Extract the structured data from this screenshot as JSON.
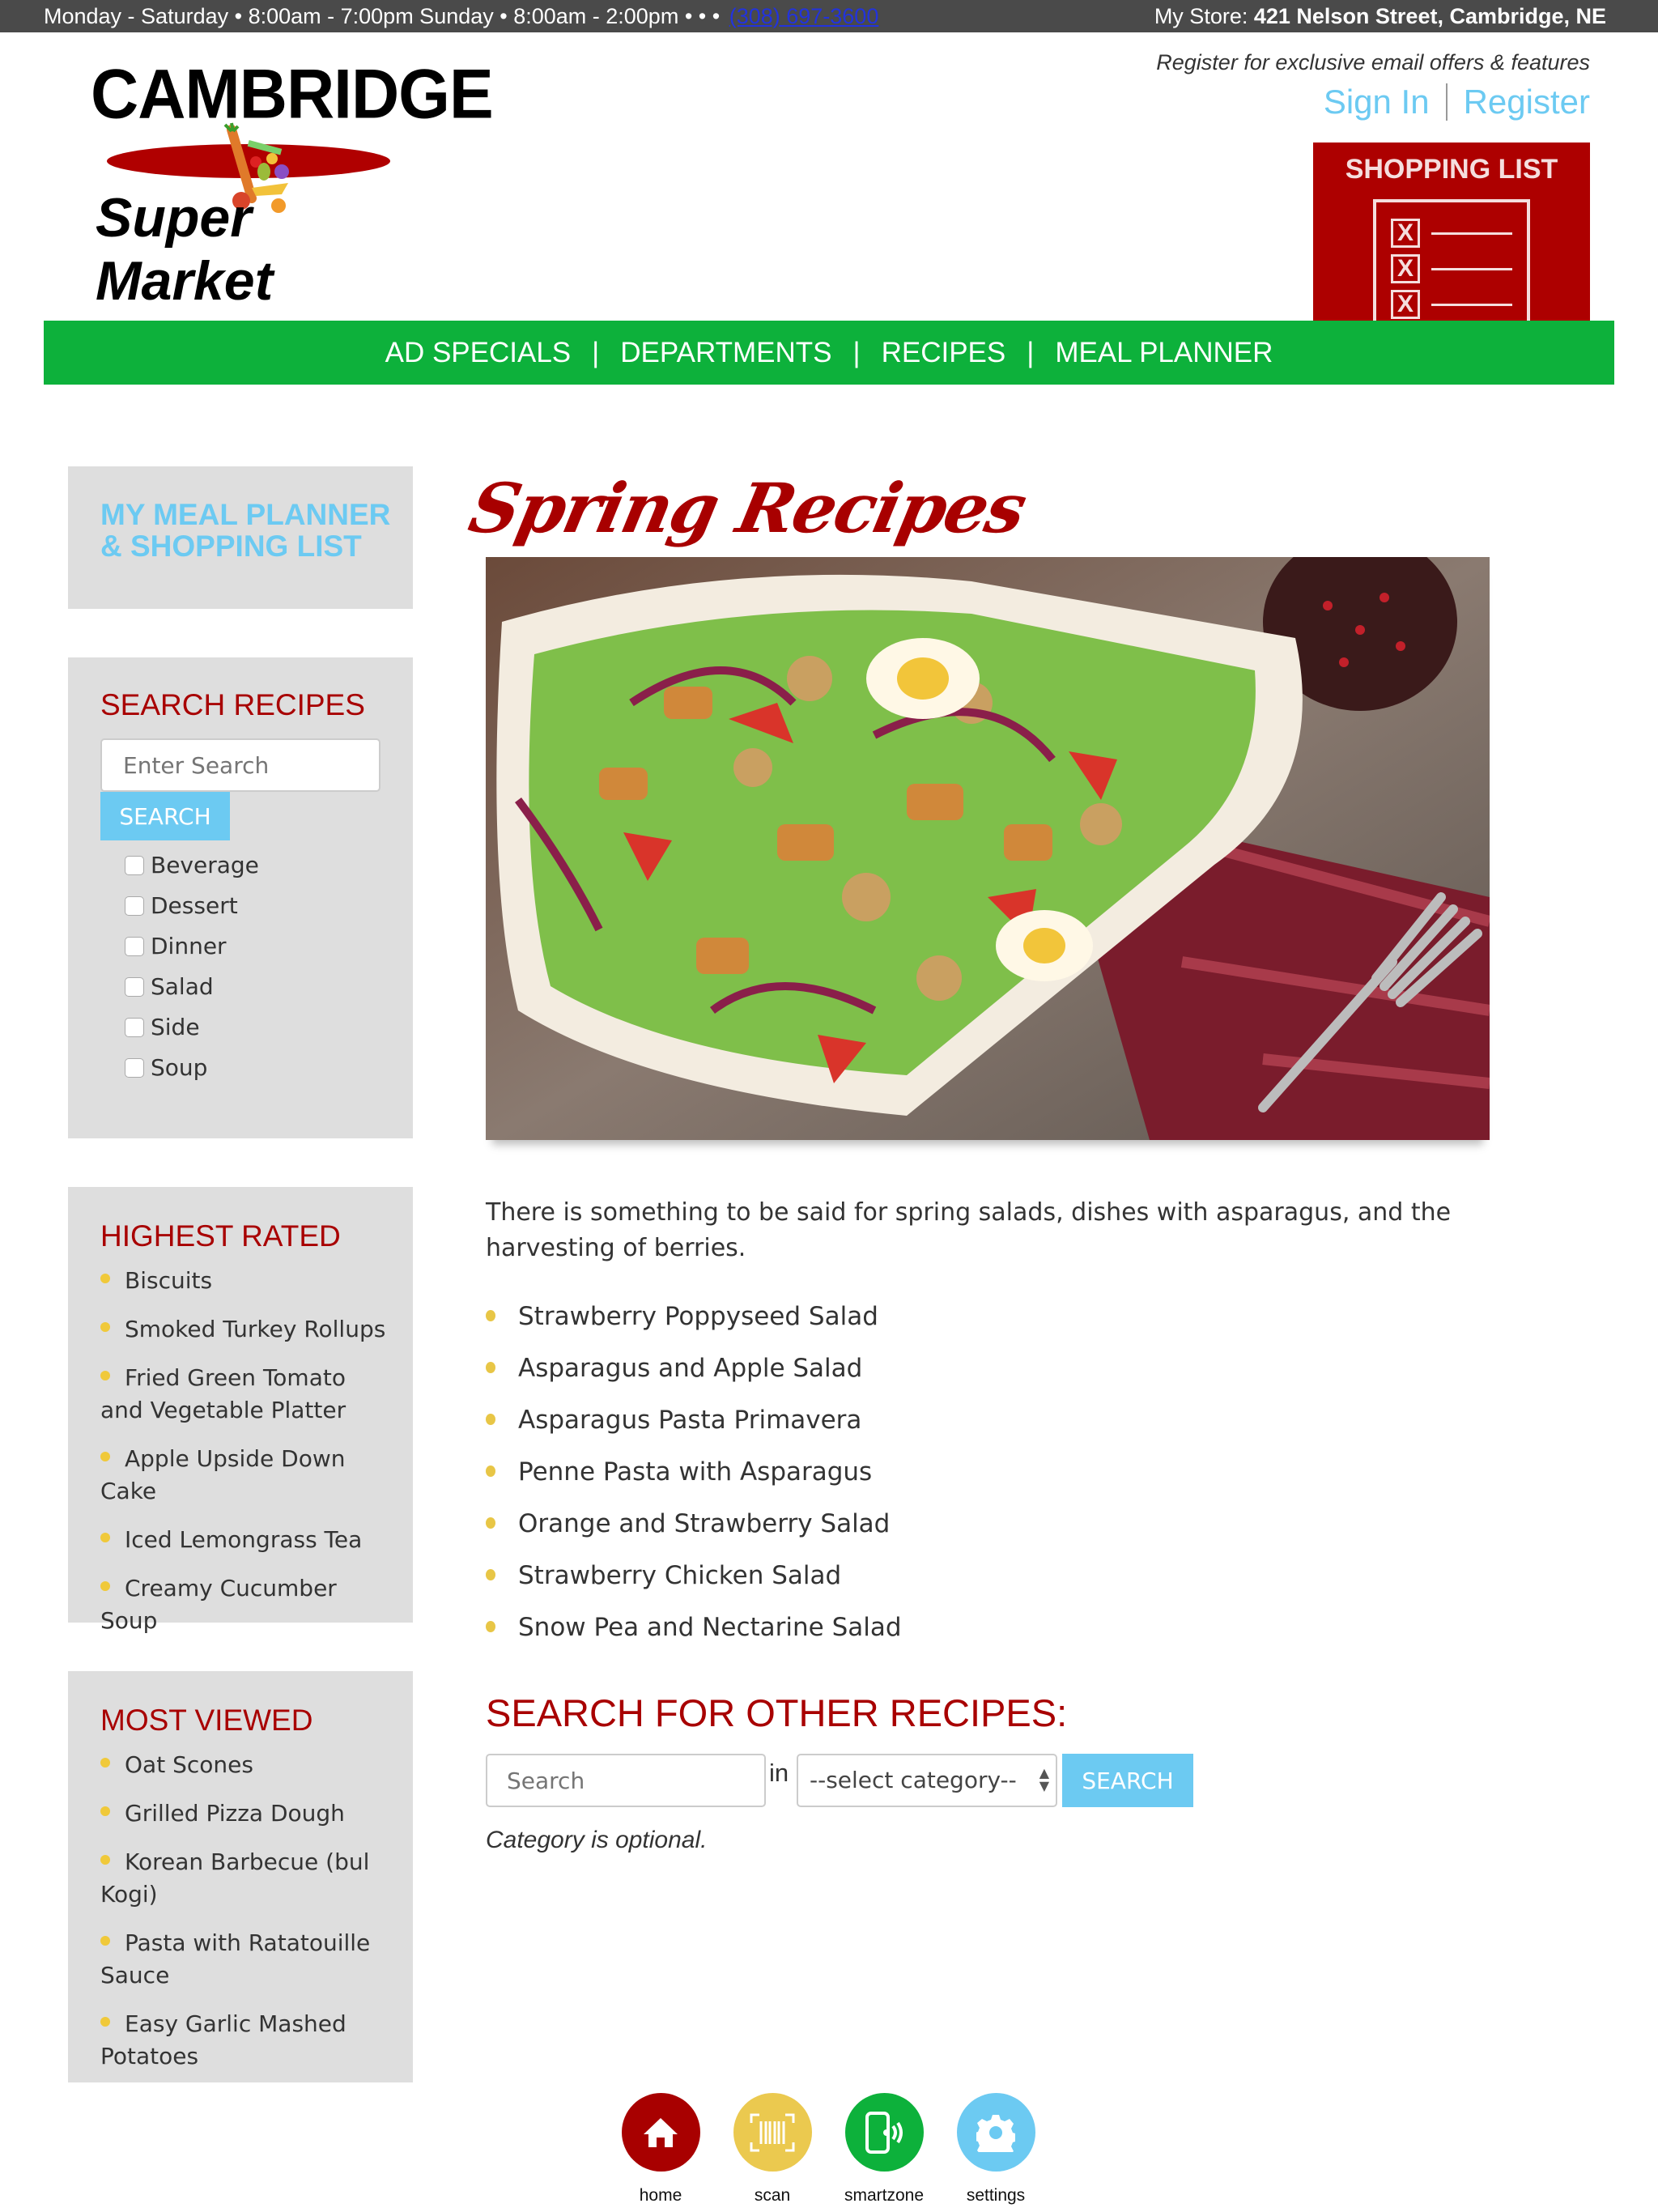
{
  "topbar": {
    "hours": "Monday - Saturday • 8:00am - 7:00pm Sunday • 8:00am - 2:00pm • • •",
    "phone": "(308) 697-3600",
    "store_label": "My Store:",
    "store_address": "421 Nelson Street, Cambridge, NE"
  },
  "logo": {
    "line1": "CAMBRIDGE",
    "line2": "Super Market"
  },
  "account": {
    "register_prompt": "Register for exclusive email offers & features",
    "sign_in": "Sign In",
    "register": "Register"
  },
  "shopping_list_badge": {
    "label": "SHOPPING LIST",
    "icon": "checklist-icon"
  },
  "nav": {
    "items": [
      "AD SPECIALS",
      "DEPARTMENTS",
      "RECIPES",
      "MEAL PLANNER"
    ],
    "separator": "|"
  },
  "sidebar": {
    "meal_planner": {
      "line1": "MY MEAL PLANNER",
      "line2": "& SHOPPING LIST"
    },
    "search": {
      "title": "SEARCH RECIPES",
      "placeholder": "Enter Search",
      "button": "SEARCH",
      "categories": [
        "Beverage",
        "Dessert",
        "Dinner",
        "Salad",
        "Side",
        "Soup"
      ]
    },
    "highest_rated": {
      "title": "HIGHEST RATED",
      "items": [
        "Biscuits",
        "Smoked Turkey Rollups",
        "Fried Green Tomato and Vegetable Platter",
        "Apple Upside Down Cake",
        "Iced Lemongrass Tea",
        "Creamy Cucumber Soup"
      ]
    },
    "most_viewed": {
      "title": "MOST VIEWED",
      "items": [
        "Oat Scones",
        "Grilled Pizza Dough",
        "Korean Barbecue (bul Kogi)",
        "Pasta with Ratatouille Sauce",
        "Easy Garlic Mashed Potatoes"
      ]
    }
  },
  "main": {
    "title": "Spring Recipes",
    "hero_alt": "salad-with-chicken-walnuts-egg-tomato",
    "intro": "There is something to be said for spring salads, dishes with asparagus, and the harvesting of berries.",
    "recipes": [
      "Strawberry Poppyseed Salad",
      "Asparagus and Apple Salad",
      "Asparagus Pasta Primavera",
      "Penne Pasta with Asparagus",
      "Orange and Strawberry Salad",
      "Strawberry Chicken Salad",
      "Snow Pea and Nectarine Salad"
    ],
    "other_search": {
      "title": "SEARCH FOR OTHER RECIPES:",
      "placeholder": "Search",
      "in_label": "in",
      "category_selected": "--select category--",
      "button": "SEARCH",
      "note": "Category is optional."
    }
  },
  "dock": {
    "items": [
      {
        "label": "home",
        "icon": "home-icon",
        "color": "#a80000"
      },
      {
        "label": "scan",
        "icon": "barcode-scan-icon",
        "color": "#ebc94f"
      },
      {
        "label": "smartzone",
        "icon": "smartphone-signal-icon",
        "color": "#0db13b"
      },
      {
        "label": "settings",
        "icon": "gear-icon",
        "color": "#6ccaf2"
      }
    ]
  },
  "colors": {
    "brand_red": "#a80000",
    "nav_green": "#0db13b",
    "accent_blue": "#6ccaf2",
    "bullet_yellow": "#e8c646",
    "panel_gray": "#dedede",
    "topbar_gray": "#4a4a4a"
  }
}
